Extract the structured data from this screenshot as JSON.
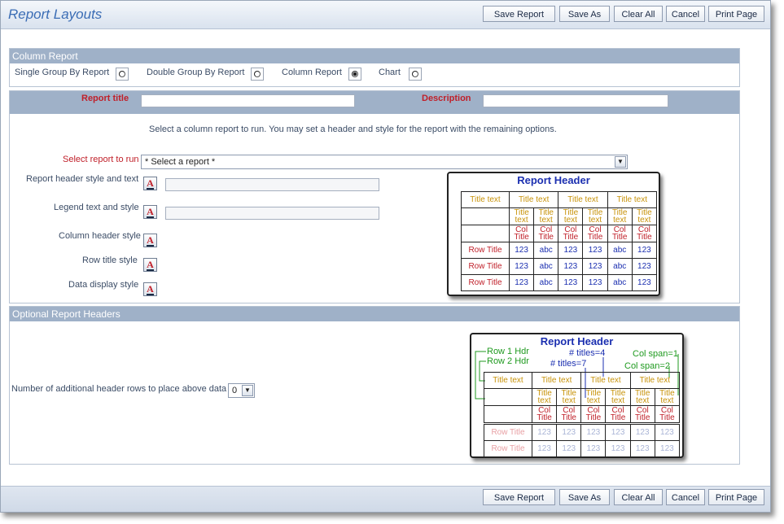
{
  "header": {
    "title": "Report Layouts",
    "buttons": [
      "Save Report",
      "Save As",
      "Clear All",
      "Cancel",
      "Print Page"
    ]
  },
  "report_type": {
    "section_title": "Column Report",
    "options": [
      {
        "label": "Single Group By Report",
        "checked": false
      },
      {
        "label": "Double Group By Report",
        "checked": false
      },
      {
        "label": "Column Report",
        "checked": true
      },
      {
        "label": "Chart",
        "checked": false
      }
    ]
  },
  "title_row": {
    "report_title_label": "Report title",
    "report_title_value": "",
    "description_label": "Description",
    "description_value": ""
  },
  "main": {
    "instructions": "Select a column report to run.  You may set a header and style for the report with the remaining options.",
    "select_report_label": "Select report to run",
    "select_report_value": "* Select a report *",
    "style_rows": [
      {
        "label": "Report header style and text",
        "has_text": true
      },
      {
        "label": "Legend text and style",
        "has_text": true
      },
      {
        "label": "Column header style",
        "has_text": false
      },
      {
        "label": "Row title style",
        "has_text": false
      },
      {
        "label": "Data display style",
        "has_text": false
      }
    ],
    "style_button_glyph": "A"
  },
  "preview1": {
    "title": "Report Header",
    "title_text": "Title text",
    "sub_title": [
      "Title",
      "text"
    ],
    "col_title": [
      "Col",
      "Title"
    ],
    "row_title": "Row Title",
    "row_values": [
      "123",
      "abc",
      "123",
      "123",
      "abc",
      "123"
    ]
  },
  "optional": {
    "section_title": "Optional Report Headers",
    "rows_label": "Number of additional header rows to place above data",
    "rows_value": "0"
  },
  "preview2": {
    "title": "Report Header",
    "ann_row1": "Row 1 Hdr",
    "ann_row2": "Row 2 Hdr",
    "ann_titles4": "# titles=4",
    "ann_titles7": "# titles=7",
    "ann_colspan1": "Col span=1",
    "ann_colspan2": "Col span=2",
    "title_text": "Title text",
    "row_title": "Row Title",
    "row_values": [
      "123",
      "123",
      "123",
      "123",
      "123",
      "123"
    ]
  },
  "footer": {
    "buttons": [
      "Save Report",
      "Save As",
      "Clear All",
      "Cancel",
      "Print Page"
    ]
  }
}
